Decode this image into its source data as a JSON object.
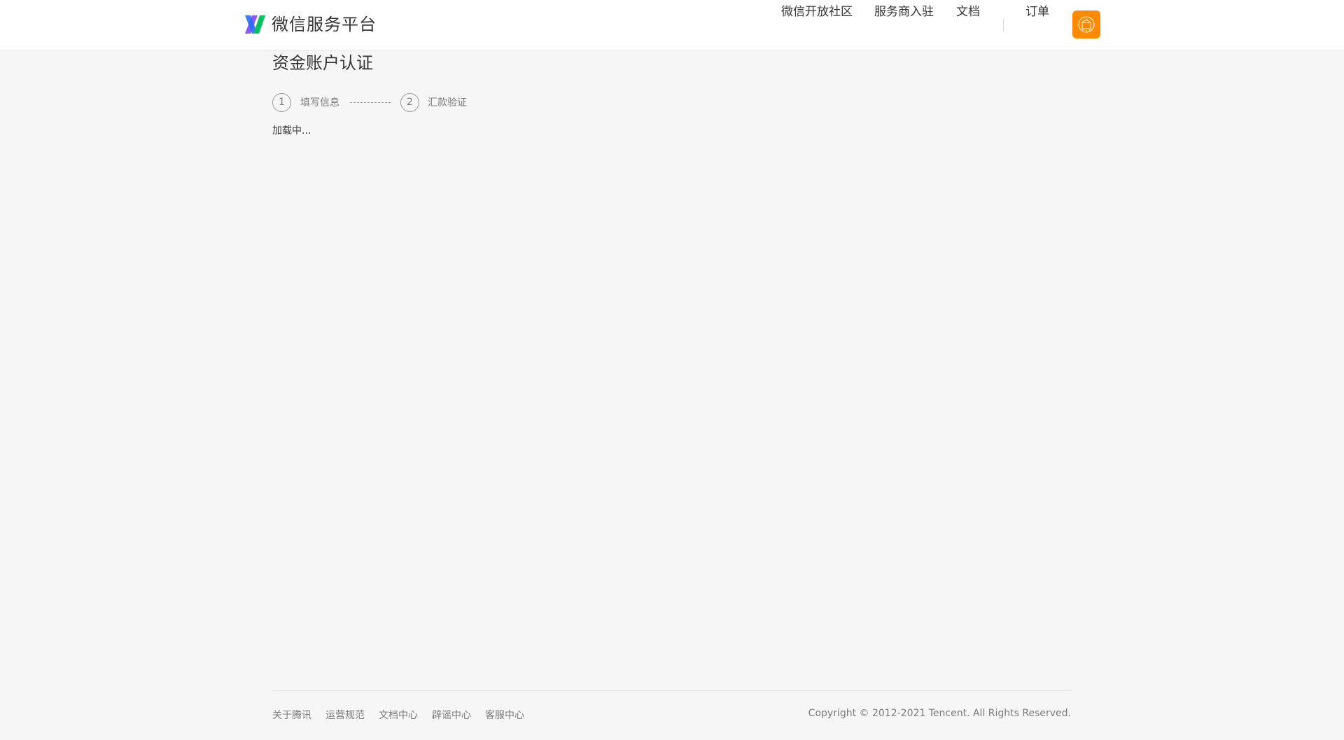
{
  "header": {
    "logo_text": "微信服务平台",
    "nav": {
      "community": "微信开放社区",
      "merchant": "服务商入驻",
      "docs": "文档",
      "orders": "订单"
    },
    "avatar_color": "#ff8a00"
  },
  "main": {
    "title": "资金账户认证",
    "steps": [
      {
        "number": "1",
        "label": "填写信息"
      },
      {
        "number": "2",
        "label": "汇款验证"
      }
    ],
    "loading_text": "加载中..."
  },
  "footer": {
    "links": [
      "关于腾讯",
      "运营规范",
      "文档中心",
      "辟谣中心",
      "客服中心"
    ],
    "copyright": "Copyright © 2012-2021 Tencent. All Rights Reserved."
  },
  "colors": {
    "logo_green": "#07c160",
    "logo_blue": "#2b6cf6",
    "logo_purple": "#8a5cf6",
    "accent_orange": "#ff8a00"
  }
}
